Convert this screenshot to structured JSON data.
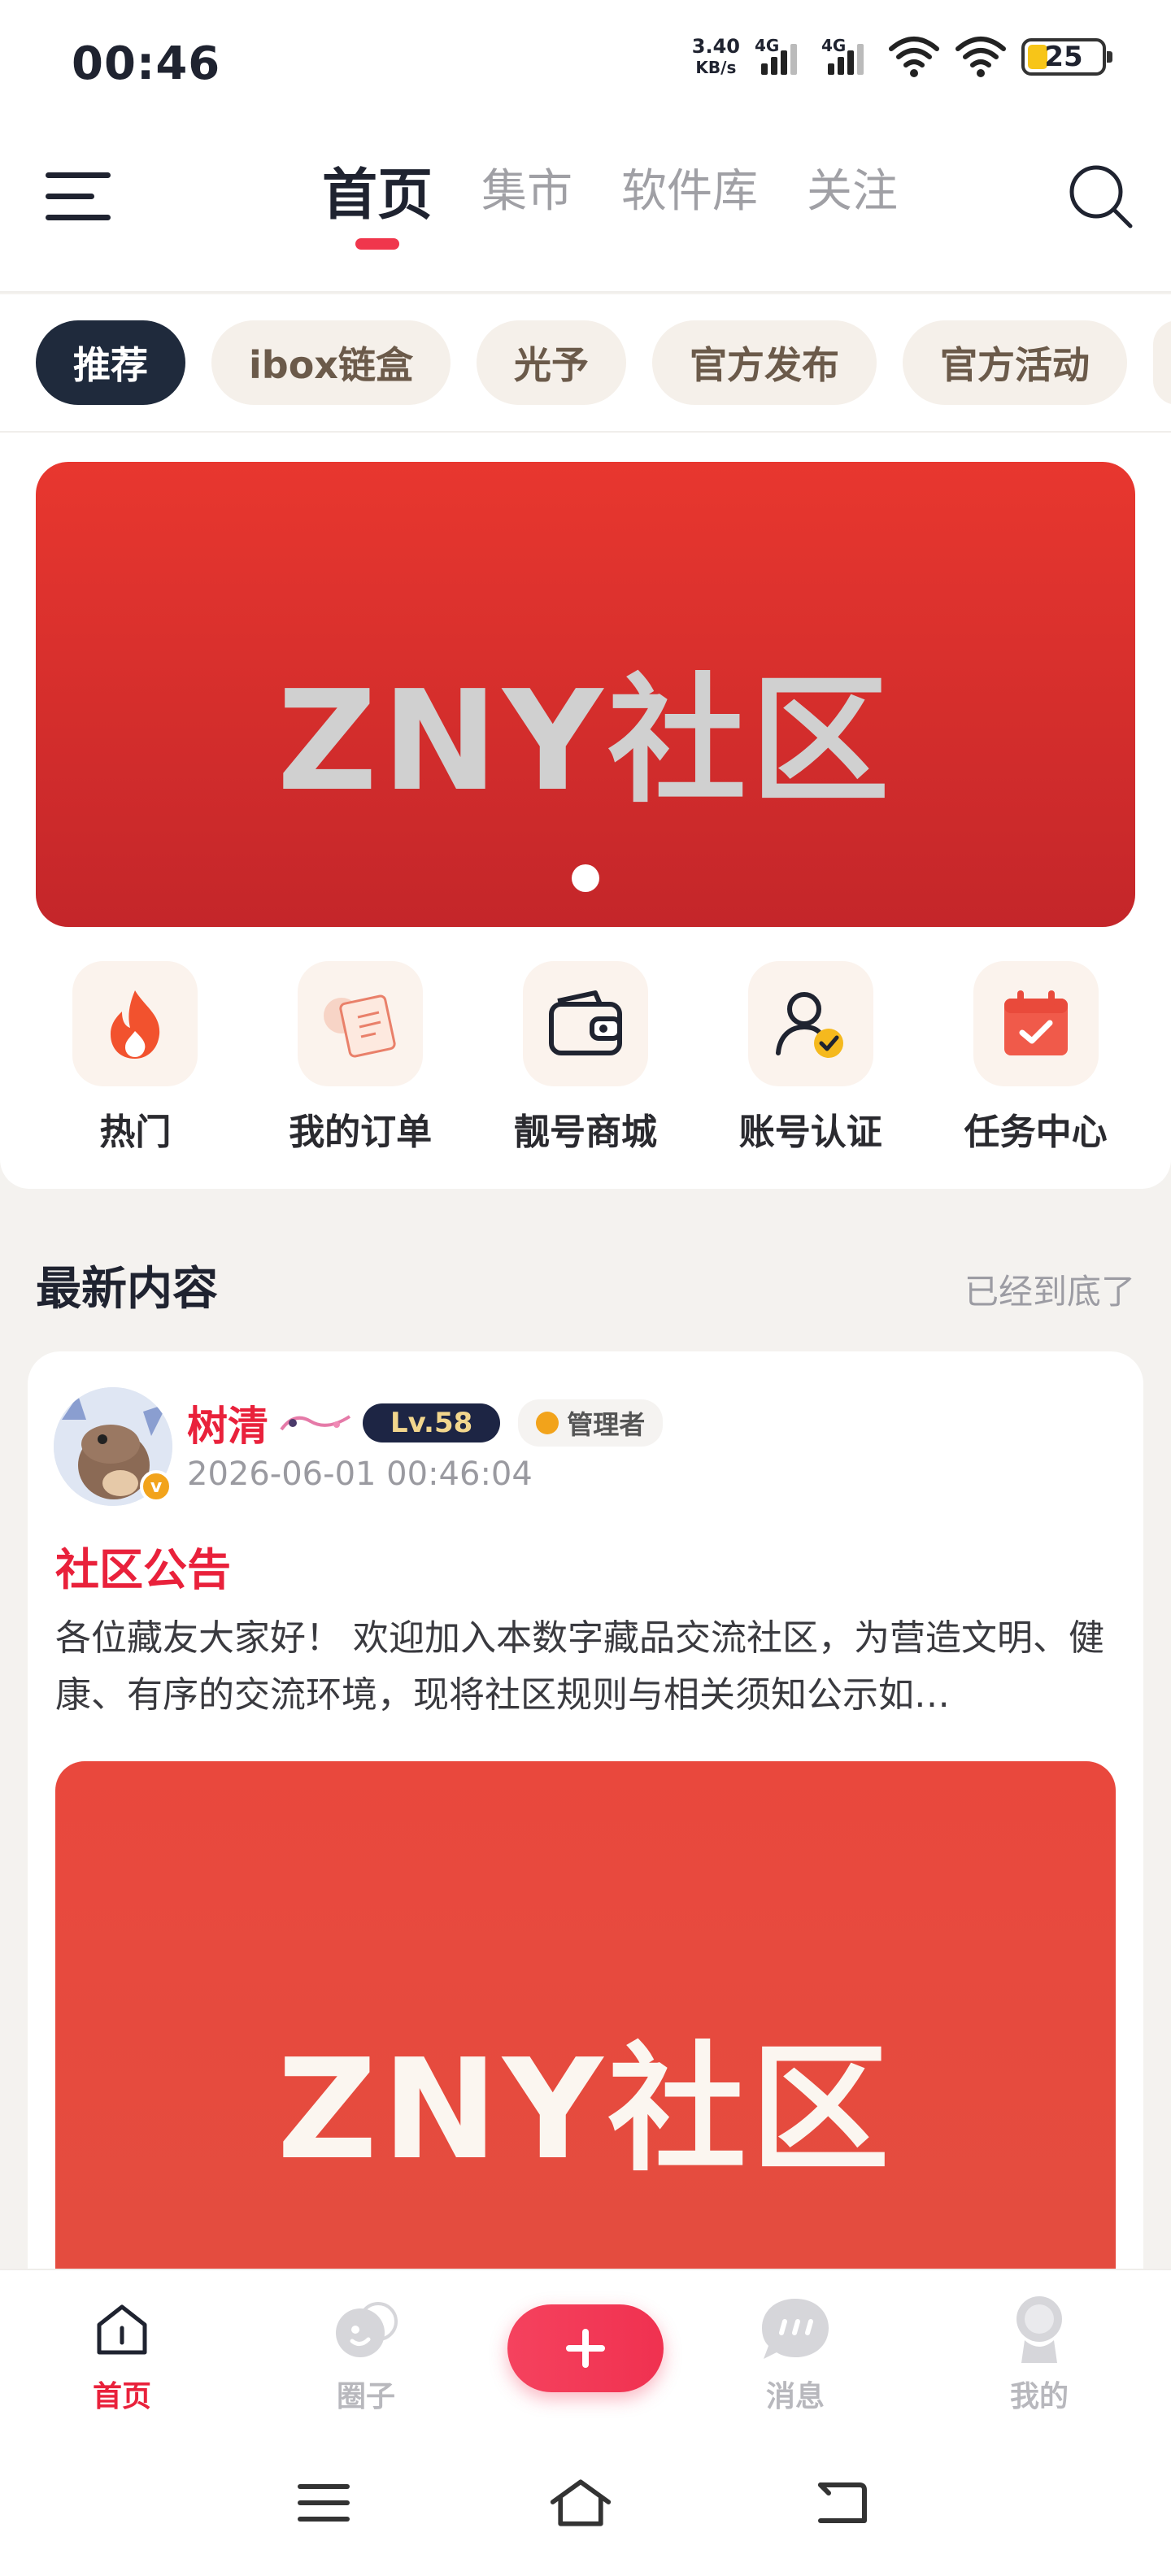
{
  "status_bar": {
    "time": "00:46",
    "net_speed_value": "3.40",
    "net_speed_unit": "KB/s",
    "sim1_label": "4G",
    "sim2_label": "4G",
    "battery": "25",
    "battery_color": "#f7c518"
  },
  "header": {
    "menu_icon": "hamburger-menu-icon",
    "tabs": [
      {
        "label": "首页",
        "active": true
      },
      {
        "label": "集市",
        "active": false
      },
      {
        "label": "软件库",
        "active": false
      },
      {
        "label": "关注",
        "active": false
      }
    ],
    "search_icon": "search-icon",
    "accent_color": "#f0364c"
  },
  "categories": [
    {
      "label": "推荐",
      "active": true
    },
    {
      "label": "ibox链盒",
      "active": false
    },
    {
      "label": "光予",
      "active": false
    },
    {
      "label": "官方发布",
      "active": false
    },
    {
      "label": "官方活动",
      "active": false
    }
  ],
  "banner": {
    "text": "ZNY社区",
    "background": "#e03530"
  },
  "quick_links": [
    {
      "label": "热门",
      "icon": "flame-icon"
    },
    {
      "label": "我的订单",
      "icon": "order-receipt-icon"
    },
    {
      "label": "靓号商城",
      "icon": "wallet-icon"
    },
    {
      "label": "账号认证",
      "icon": "user-verified-icon"
    },
    {
      "label": "任务中心",
      "icon": "calendar-check-icon"
    }
  ],
  "feed": {
    "section_title": "最新内容",
    "end_text": "已经到底了",
    "posts": [
      {
        "author": "树清",
        "level": "Lv.58",
        "role": "管理者",
        "avatar_badge": "v",
        "time": "2026-06-01 00:46:04",
        "title": "社区公告",
        "body": "各位藏友大家好！ 欢迎加入本数字藏品交流社区，为营造文明、健康、有序的交流环境，现将社区规则与相关须知公示如…",
        "image_text": "ZNY社区"
      }
    ]
  },
  "tab_bar": {
    "tabs": [
      {
        "label": "首页",
        "icon": "home-icon",
        "active": true
      },
      {
        "label": "圈子",
        "icon": "circle-group-icon",
        "active": false
      },
      {
        "label": "消息",
        "icon": "chat-bubble-icon",
        "active": false
      },
      {
        "label": "我的",
        "icon": "profile-icon",
        "active": false
      }
    ],
    "add_icon": "plus-icon"
  },
  "system_nav": {
    "menu_icon": "recent-apps-icon",
    "home_icon": "system-home-icon",
    "back_icon": "back-icon"
  }
}
